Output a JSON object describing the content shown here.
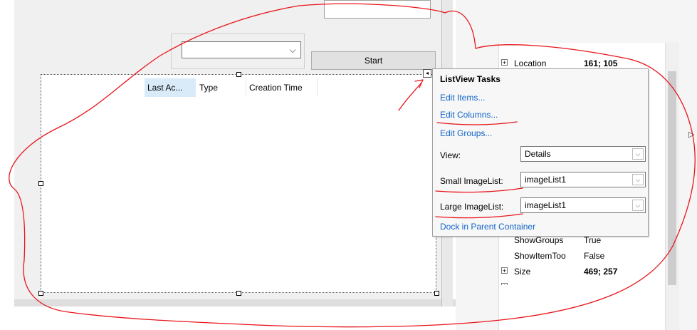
{
  "form": {
    "start_button": "Start",
    "combo_arrow": "⌵"
  },
  "listview": {
    "columns": [
      "Last Ac...",
      "Type",
      "Creation Time"
    ],
    "smart_tag_glyph": "◂"
  },
  "tasks": {
    "title": "ListView Tasks",
    "edit_items": "Edit Items...",
    "edit_columns": "Edit Columns...",
    "edit_groups": "Edit Groups...",
    "view_label": "View:",
    "view_value": "Details",
    "small_imagelist_label": "Small ImageList:",
    "small_imagelist_value": "imageList1",
    "large_imagelist_label": "Large ImageList:",
    "large_imagelist_value": "imageList1",
    "dock": "Dock in Parent Container",
    "dropdown_arrow": "⌵"
  },
  "properties": {
    "expand_glyph": "+",
    "rows": [
      {
        "name": "Location",
        "value": "161; 105"
      },
      {
        "name": "ShowGroups",
        "value": "True"
      },
      {
        "name": "ShowItemToo",
        "value": "False"
      },
      {
        "name": "Size",
        "value": "469; 257"
      }
    ],
    "edge_arrow": "▷"
  },
  "colors": {
    "annotation_red": "#e8151b",
    "link_blue": "#1064c8",
    "selected_header": "#d9ebf9"
  }
}
